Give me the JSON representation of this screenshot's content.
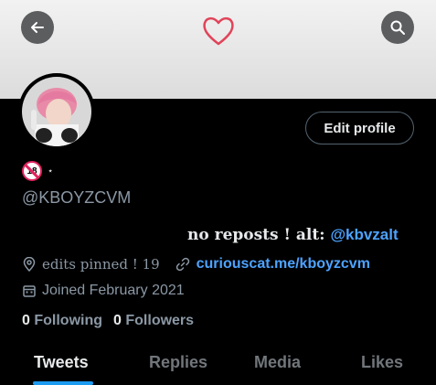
{
  "header": {
    "back_icon": "arrow-left-icon",
    "search_icon": "search-icon",
    "banner_icon": "heart-icon"
  },
  "profile": {
    "edit_label": "Edit profile",
    "name_badge": "18",
    "name_suffix": "⋆",
    "handle": "@KBOYZCVM",
    "bio_text": "no reposts ! alt:",
    "bio_mention": "@kbvzalt",
    "location": "edits pinned ! 19",
    "website": "curiouscat.me/kboyzcvm",
    "joined": "Joined February 2021",
    "following_count": "0",
    "following_label": "Following",
    "followers_count": "0",
    "followers_label": "Followers"
  },
  "tabs": [
    {
      "label": "Tweets",
      "active": true
    },
    {
      "label": "Replies"
    },
    {
      "label": "Media"
    },
    {
      "label": "Likes"
    }
  ],
  "colors": {
    "accent": "#1d9bf0",
    "link": "#4da3ff",
    "heart": "#e0445a"
  }
}
